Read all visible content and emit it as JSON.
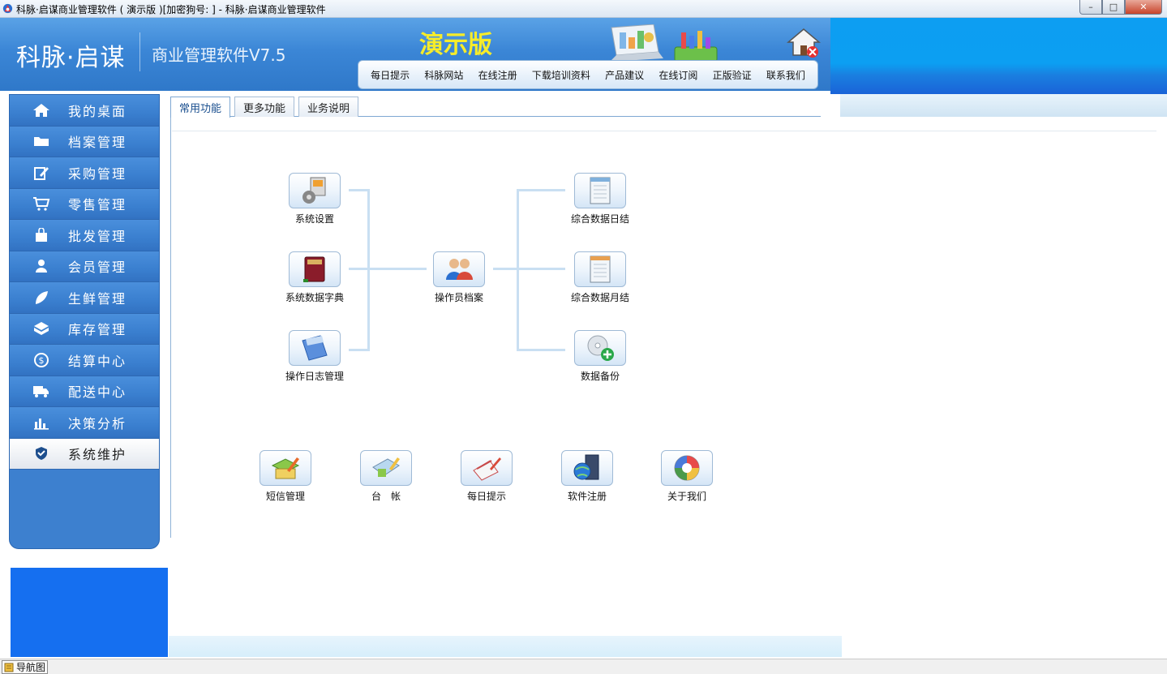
{
  "window": {
    "title": "科脉·启谋商业管理软件 ( 演示版 )[加密狗号: ] - 科脉·启谋商业管理软件",
    "minimize_glyph": "–",
    "maximize_glyph": "□",
    "close_glyph": "✕"
  },
  "header": {
    "brand": "科脉·启谋",
    "subtitle": "商业管理软件V7.5",
    "demo_label": "演示版",
    "nav": [
      "每日提示",
      "科脉网站",
      "在线注册",
      "下载培训资料",
      "产品建议",
      "在线订阅",
      "正版验证",
      "联系我们"
    ]
  },
  "sidebar": {
    "items": [
      {
        "label": "我的桌面",
        "icon": "home-icon"
      },
      {
        "label": "档案管理",
        "icon": "folder-icon"
      },
      {
        "label": "采购管理",
        "icon": "edit-icon"
      },
      {
        "label": "零售管理",
        "icon": "cart-icon"
      },
      {
        "label": "批发管理",
        "icon": "bag-icon"
      },
      {
        "label": "会员管理",
        "icon": "user-icon"
      },
      {
        "label": "生鲜管理",
        "icon": "leaf-icon"
      },
      {
        "label": "库存管理",
        "icon": "box-icon"
      },
      {
        "label": "结算中心",
        "icon": "dollar-icon"
      },
      {
        "label": "配送中心",
        "icon": "truck-icon"
      },
      {
        "label": "决策分析",
        "icon": "chart-icon"
      },
      {
        "label": "系统维护",
        "icon": "shield-icon",
        "active": true
      }
    ]
  },
  "tabs": [
    "常用功能",
    "更多功能",
    "业务说明"
  ],
  "functions": {
    "system_settings": "系统设置",
    "data_dictionary": "系统数据字典",
    "operation_log": "操作日志管理",
    "operator_profile": "操作员档案",
    "daily_summary": "综合数据日结",
    "monthly_summary": "综合数据月结",
    "data_backup": "数据备份",
    "sms": "短信管理",
    "ledger": "台　帐",
    "daily_tips": "每日提示",
    "register": "软件注册",
    "about": "关于我们"
  },
  "statusbar": {
    "tab": "导航图"
  },
  "colors": {
    "sidebar": "#3d80cf",
    "header": "#3b86d6",
    "demo_text": "#f6ec2a",
    "accent_blue": "#156ff0"
  }
}
